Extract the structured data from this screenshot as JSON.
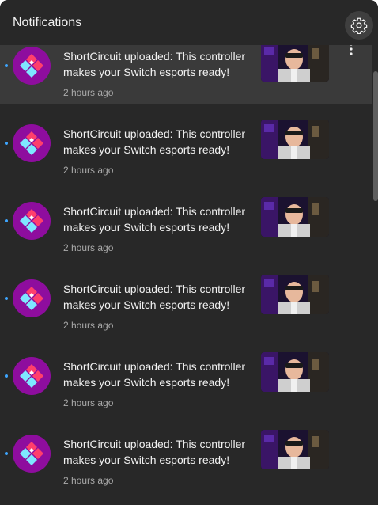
{
  "header": {
    "title": "Notifications",
    "settings_icon": "gear-icon"
  },
  "notifications": [
    {
      "text": "ShortCircuit uploaded: This controller makes your Switch esports ready!",
      "time": "2 hours ago",
      "unread": true,
      "hovered": true
    },
    {
      "text": "ShortCircuit uploaded: This controller makes your Switch esports ready!",
      "time": "2 hours ago",
      "unread": true,
      "hovered": false
    },
    {
      "text": "ShortCircuit uploaded: This controller makes your Switch esports ready!",
      "time": "2 hours ago",
      "unread": true,
      "hovered": false
    },
    {
      "text": "ShortCircuit uploaded: This controller makes your Switch esports ready!",
      "time": "2 hours ago",
      "unread": true,
      "hovered": false
    },
    {
      "text": "ShortCircuit uploaded: This controller makes your Switch esports ready!",
      "time": "2 hours ago",
      "unread": true,
      "hovered": false
    },
    {
      "text": "ShortCircuit uploaded: This controller makes your Switch esports ready!",
      "time": "2 hours ago",
      "unread": true,
      "hovered": false
    }
  ],
  "colors": {
    "panel_bg": "#282828",
    "hover_bg": "#3a3a3a",
    "unread_dot": "#3ea6ff",
    "avatar_bg": "#8e0d9e",
    "primary_text": "#f1f1f1",
    "secondary_text": "#aaaaaa"
  }
}
